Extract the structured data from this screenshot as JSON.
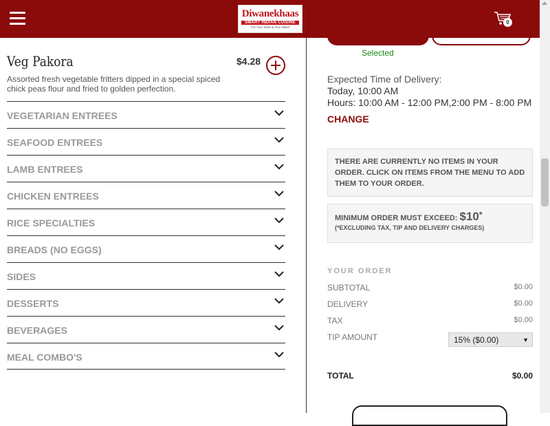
{
  "header": {
    "logo": {
      "name": "Diwanekhaas",
      "tagline": "SMART INDIAN CUISINE",
      "subtagline": "For Your Taste & Your Waist"
    },
    "cart_count": "0",
    "brand_color": "#8b0a0a"
  },
  "menu_item": {
    "title": "Veg Pakora",
    "price": "$4.28",
    "description": "Assorted fresh vegetable fritters dipped in a special spiced chick peas flour and fried to golden perfection."
  },
  "categories": [
    {
      "label": "VEGETARIAN ENTREES"
    },
    {
      "label": "SEAFOOD ENTREES"
    },
    {
      "label": "LAMB ENTREES"
    },
    {
      "label": "CHICKEN ENTREES"
    },
    {
      "label": "RICE SPECIALTIES"
    },
    {
      "label": "BREADS (NO EGGS)"
    },
    {
      "label": "SIDES"
    },
    {
      "label": "DESSERTS"
    },
    {
      "label": "BEVERAGES"
    },
    {
      "label": "MEAL COMBO'S"
    }
  ],
  "order_panel": {
    "selected_label": "Selected",
    "delivery": {
      "label": "Expected Time of Delivery:",
      "time": "Today, 10:00 AM",
      "hours": "Hours: 10:00 AM - 12:00 PM,2:00 PM - 8:00 PM",
      "change_label": "CHANGE"
    },
    "empty_notice": "THERE ARE CURRENTLY NO ITEMS IN YOUR ORDER. CLICK ON ITEMS FROM THE MENU TO ADD THEM TO YOUR ORDER.",
    "minimum": {
      "label": "MINIMUM ORDER MUST EXCEED:",
      "amount": "$10",
      "star": "*",
      "note": "(*EXCLUDING TAX, TIP AND DELIVERY CHARGES)"
    },
    "your_order": {
      "title": "YOUR ORDER",
      "subtotal_label": "SUBTOTAL",
      "subtotal": "$0.00",
      "delivery_label": "DELIVERY",
      "delivery": "$0.00",
      "tax_label": "TAX",
      "tax": "$0.00",
      "tip_label": "TIP AMOUNT",
      "tip_selected": "15% ($0.00)",
      "total_label": "TOTAL",
      "total": "$0.00"
    }
  }
}
